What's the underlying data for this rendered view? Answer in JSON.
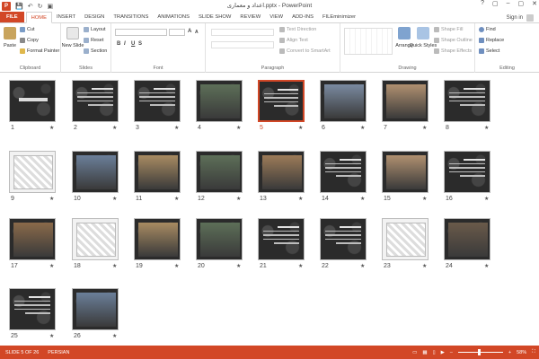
{
  "window": {
    "title": "اعداد و معماری.pptx - PowerPoint",
    "app_icon": "P",
    "controls": [
      "?",
      "▢",
      "–",
      "▢",
      "✕"
    ]
  },
  "qat": {
    "save": "💾",
    "undo": "↶",
    "redo": "↻",
    "present": "▣"
  },
  "tabs": [
    "FILE",
    "HOME",
    "INSERT",
    "DESIGN",
    "TRANSITIONS",
    "ANIMATIONS",
    "SLIDE SHOW",
    "REVIEW",
    "VIEW",
    "ADD-INS",
    "FILEminimizer"
  ],
  "active_tab": "HOME",
  "signin": "Sign in",
  "ribbon": {
    "clipboard": {
      "label": "Clipboard",
      "paste": "Paste",
      "cut": "Cut",
      "copy": "Copy",
      "format_painter": "Format Painter"
    },
    "slides": {
      "label": "Slides",
      "new_slide": "New Slide",
      "layout": "Layout",
      "reset": "Reset",
      "section": "Section"
    },
    "font": {
      "label": "Font",
      "bold": "B",
      "italic": "I",
      "underline": "U",
      "strike": "S",
      "size_up": "A",
      "size_down": "A"
    },
    "paragraph": {
      "label": "Paragraph",
      "text_direction": "Text Direction",
      "align_text": "Align Text",
      "convert_smartart": "Convert to SmartArt"
    },
    "drawing": {
      "label": "Drawing",
      "arrange": "Arrange",
      "quick_styles": "Quick Styles",
      "shape_fill": "Shape Fill",
      "shape_outline": "Shape Outline",
      "shape_effects": "Shape Effects"
    },
    "editing": {
      "label": "Editing",
      "find": "Find",
      "replace": "Replace",
      "select": "Select"
    }
  },
  "slides": [
    {
      "num": "1"
    },
    {
      "num": "2"
    },
    {
      "num": "3"
    },
    {
      "num": "4"
    },
    {
      "num": "5"
    },
    {
      "num": "6"
    },
    {
      "num": "7"
    },
    {
      "num": "8"
    },
    {
      "num": "9"
    },
    {
      "num": "10"
    },
    {
      "num": "11"
    },
    {
      "num": "12"
    },
    {
      "num": "13"
    },
    {
      "num": "14"
    },
    {
      "num": "15"
    },
    {
      "num": "16"
    },
    {
      "num": "17"
    },
    {
      "num": "18"
    },
    {
      "num": "19"
    },
    {
      "num": "20"
    },
    {
      "num": "21"
    },
    {
      "num": "22"
    },
    {
      "num": "23"
    },
    {
      "num": "24"
    },
    {
      "num": "25"
    },
    {
      "num": "26"
    }
  ],
  "selected_slide": "5",
  "slide_star": "★",
  "status": {
    "slide_info": "SLIDE 5 OF 26",
    "language": "PERSIAN",
    "zoom_minus": "–",
    "zoom_plus": "+",
    "zoom": "58%"
  },
  "colors": {
    "accent": "#d24726",
    "dark_slide": "#2b2b2b"
  }
}
